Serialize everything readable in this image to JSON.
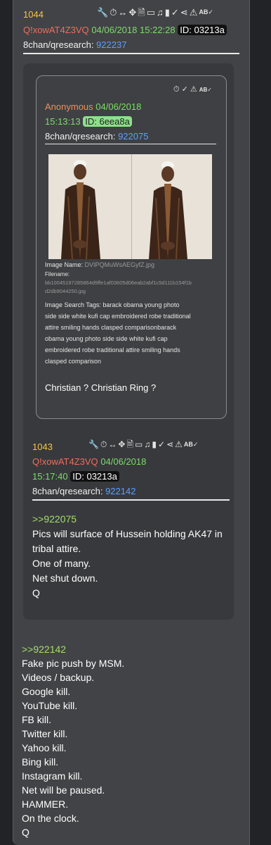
{
  "post1044": {
    "number": "1044",
    "tripcode": "Q!xowAT4Z3VQ",
    "date": "04/06/2018",
    "time": "15:22:28",
    "id": "ID: 03213a",
    "board": "8chan/qresearch:",
    "post_link": "922237",
    "icons": [
      "wrench-icon",
      "timer-icon",
      "arrows-h-icon",
      "move-icon",
      "document-icon",
      "vr-icon",
      "music-icon",
      "clipboard-icon",
      "clipboard-check-icon",
      "share-icon",
      "warning-icon",
      "ab-check-icon"
    ]
  },
  "quoted_post": {
    "author": "Anonymous",
    "date": "04/06/2018",
    "time": "15:13:13",
    "id": "ID: 6eea8a",
    "board": "8chan/qresearch:",
    "post_link": "922075",
    "image_name_label": "Image Name:",
    "image_name": "DVIPQMuWsAEGyfZ.jpg",
    "filename_label": "Filename:",
    "filename_line1": "bb10045197285864d9ffe1af03605d06eab2abf1c5d111b154f1b",
    "filename_line2": "d2db9044250.jpg",
    "tags_label": "Image Search Tags:",
    "tags_line1": "barack obama young photo",
    "tags_line2": "side side white kufi cap embroidered robe traditional",
    "tags_line3": "attire smiling hands clasped comparisonbarack",
    "tags_line4": "obama young photo side side white kufi cap",
    "tags_line5": "embroidered robe traditional attire smiling hands",
    "tags_line6": "clasped comparison",
    "message": "Christian ? Christian Ring ?",
    "icons": [
      "timer-icon",
      "clipboard-check-icon",
      "warning-icon",
      "ab-check-icon"
    ]
  },
  "post1043": {
    "number": "1043",
    "tripcode": "Q!xowAT4Z3VQ",
    "date": "04/06/2018",
    "time": "15:17:40",
    "id": "ID: 03213a",
    "board": "8chan/qresearch:",
    "post_link": "922142",
    "reply_link": ">>922075",
    "lines": [
      "Pics will surface of Hussein holding AK47 in",
      "tribal attire.",
      "One of many.",
      "Net shut down.",
      "Q"
    ]
  },
  "post1044_body": {
    "reply_link": ">>922142",
    "lines": [
      "Fake pic push by MSM.",
      "Videos / backup.",
      "Google kill.",
      "YouTube kill.",
      "FB kill.",
      "Twitter kill.",
      "Yahoo kill.",
      "Bing kill.",
      "Instagram kill.",
      "Net will be paused.",
      "HAMMER.",
      "On the clock.",
      "Q"
    ]
  }
}
